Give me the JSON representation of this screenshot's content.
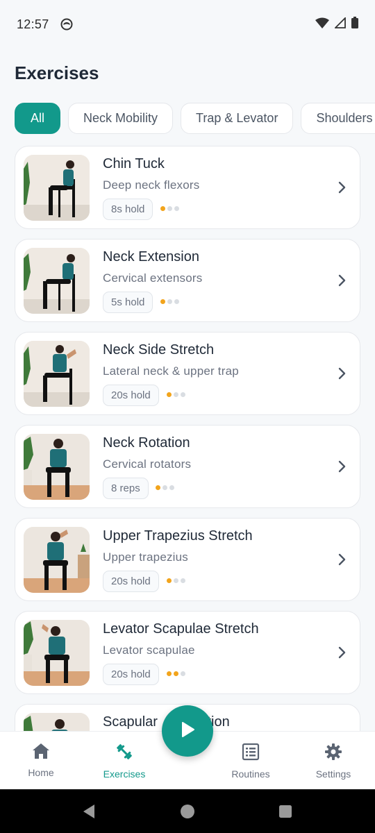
{
  "status_bar": {
    "time": "12:57"
  },
  "header": {
    "title": "Exercises"
  },
  "filters": [
    {
      "label": "All",
      "active": true
    },
    {
      "label": "Neck Mobility",
      "active": false
    },
    {
      "label": "Trap & Levator",
      "active": false
    },
    {
      "label": "Shoulders",
      "active": false
    }
  ],
  "exercises": [
    {
      "name": "Chin Tuck",
      "target": "Deep neck flexors",
      "tag": "8s hold",
      "difficulty": 1
    },
    {
      "name": "Neck Extension",
      "target": "Cervical extensors",
      "tag": "5s hold",
      "difficulty": 1
    },
    {
      "name": "Neck Side Stretch",
      "target": "Lateral neck & upper trap",
      "tag": "20s hold",
      "difficulty": 1
    },
    {
      "name": "Neck Rotation",
      "target": "Cervical rotators",
      "tag": "8 reps",
      "difficulty": 1
    },
    {
      "name": "Upper Trapezius Stretch",
      "target": "Upper trapezius",
      "tag": "20s hold",
      "difficulty": 1
    },
    {
      "name": "Levator Scapulae Stretch",
      "target": "Levator scapulae",
      "tag": "20s hold",
      "difficulty": 2
    },
    {
      "name": "Scapular ",
      "name_tail": "tion",
      "target": "",
      "tag": "",
      "difficulty": 0
    }
  ],
  "nav": {
    "home": "Home",
    "exercises": "Exercises",
    "routines": "Routines",
    "settings": "Settings"
  },
  "colors": {
    "accent": "#12998b",
    "difficulty": "#f2a41c"
  }
}
